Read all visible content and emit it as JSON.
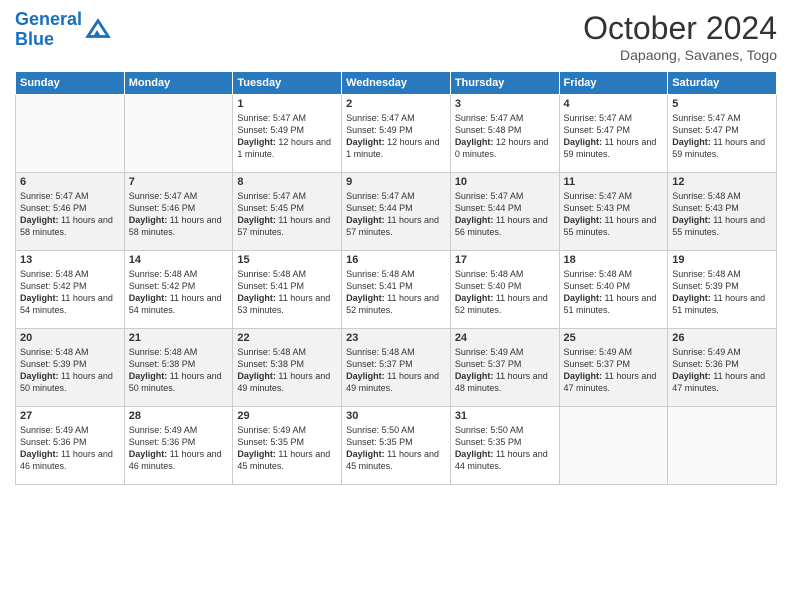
{
  "header": {
    "logo_line1": "General",
    "logo_line2": "Blue",
    "month": "October 2024",
    "location": "Dapaong, Savanes, Togo"
  },
  "days_of_week": [
    "Sunday",
    "Monday",
    "Tuesday",
    "Wednesday",
    "Thursday",
    "Friday",
    "Saturday"
  ],
  "weeks": [
    [
      {
        "day": "",
        "content": ""
      },
      {
        "day": "",
        "content": ""
      },
      {
        "day": "1",
        "content": "Sunrise: 5:47 AM\nSunset: 5:49 PM\nDaylight: 12 hours and 1 minute."
      },
      {
        "day": "2",
        "content": "Sunrise: 5:47 AM\nSunset: 5:49 PM\nDaylight: 12 hours and 1 minute."
      },
      {
        "day": "3",
        "content": "Sunrise: 5:47 AM\nSunset: 5:48 PM\nDaylight: 12 hours and 0 minutes."
      },
      {
        "day": "4",
        "content": "Sunrise: 5:47 AM\nSunset: 5:47 PM\nDaylight: 11 hours and 59 minutes."
      },
      {
        "day": "5",
        "content": "Sunrise: 5:47 AM\nSunset: 5:47 PM\nDaylight: 11 hours and 59 minutes."
      }
    ],
    [
      {
        "day": "6",
        "content": "Sunrise: 5:47 AM\nSunset: 5:46 PM\nDaylight: 11 hours and 58 minutes."
      },
      {
        "day": "7",
        "content": "Sunrise: 5:47 AM\nSunset: 5:46 PM\nDaylight: 11 hours and 58 minutes."
      },
      {
        "day": "8",
        "content": "Sunrise: 5:47 AM\nSunset: 5:45 PM\nDaylight: 11 hours and 57 minutes."
      },
      {
        "day": "9",
        "content": "Sunrise: 5:47 AM\nSunset: 5:44 PM\nDaylight: 11 hours and 57 minutes."
      },
      {
        "day": "10",
        "content": "Sunrise: 5:47 AM\nSunset: 5:44 PM\nDaylight: 11 hours and 56 minutes."
      },
      {
        "day": "11",
        "content": "Sunrise: 5:47 AM\nSunset: 5:43 PM\nDaylight: 11 hours and 55 minutes."
      },
      {
        "day": "12",
        "content": "Sunrise: 5:48 AM\nSunset: 5:43 PM\nDaylight: 11 hours and 55 minutes."
      }
    ],
    [
      {
        "day": "13",
        "content": "Sunrise: 5:48 AM\nSunset: 5:42 PM\nDaylight: 11 hours and 54 minutes."
      },
      {
        "day": "14",
        "content": "Sunrise: 5:48 AM\nSunset: 5:42 PM\nDaylight: 11 hours and 54 minutes."
      },
      {
        "day": "15",
        "content": "Sunrise: 5:48 AM\nSunset: 5:41 PM\nDaylight: 11 hours and 53 minutes."
      },
      {
        "day": "16",
        "content": "Sunrise: 5:48 AM\nSunset: 5:41 PM\nDaylight: 11 hours and 52 minutes."
      },
      {
        "day": "17",
        "content": "Sunrise: 5:48 AM\nSunset: 5:40 PM\nDaylight: 11 hours and 52 minutes."
      },
      {
        "day": "18",
        "content": "Sunrise: 5:48 AM\nSunset: 5:40 PM\nDaylight: 11 hours and 51 minutes."
      },
      {
        "day": "19",
        "content": "Sunrise: 5:48 AM\nSunset: 5:39 PM\nDaylight: 11 hours and 51 minutes."
      }
    ],
    [
      {
        "day": "20",
        "content": "Sunrise: 5:48 AM\nSunset: 5:39 PM\nDaylight: 11 hours and 50 minutes."
      },
      {
        "day": "21",
        "content": "Sunrise: 5:48 AM\nSunset: 5:38 PM\nDaylight: 11 hours and 50 minutes."
      },
      {
        "day": "22",
        "content": "Sunrise: 5:48 AM\nSunset: 5:38 PM\nDaylight: 11 hours and 49 minutes."
      },
      {
        "day": "23",
        "content": "Sunrise: 5:48 AM\nSunset: 5:37 PM\nDaylight: 11 hours and 49 minutes."
      },
      {
        "day": "24",
        "content": "Sunrise: 5:49 AM\nSunset: 5:37 PM\nDaylight: 11 hours and 48 minutes."
      },
      {
        "day": "25",
        "content": "Sunrise: 5:49 AM\nSunset: 5:37 PM\nDaylight: 11 hours and 47 minutes."
      },
      {
        "day": "26",
        "content": "Sunrise: 5:49 AM\nSunset: 5:36 PM\nDaylight: 11 hours and 47 minutes."
      }
    ],
    [
      {
        "day": "27",
        "content": "Sunrise: 5:49 AM\nSunset: 5:36 PM\nDaylight: 11 hours and 46 minutes."
      },
      {
        "day": "28",
        "content": "Sunrise: 5:49 AM\nSunset: 5:36 PM\nDaylight: 11 hours and 46 minutes."
      },
      {
        "day": "29",
        "content": "Sunrise: 5:49 AM\nSunset: 5:35 PM\nDaylight: 11 hours and 45 minutes."
      },
      {
        "day": "30",
        "content": "Sunrise: 5:50 AM\nSunset: 5:35 PM\nDaylight: 11 hours and 45 minutes."
      },
      {
        "day": "31",
        "content": "Sunrise: 5:50 AM\nSunset: 5:35 PM\nDaylight: 11 hours and 44 minutes."
      },
      {
        "day": "",
        "content": ""
      },
      {
        "day": "",
        "content": ""
      }
    ]
  ]
}
